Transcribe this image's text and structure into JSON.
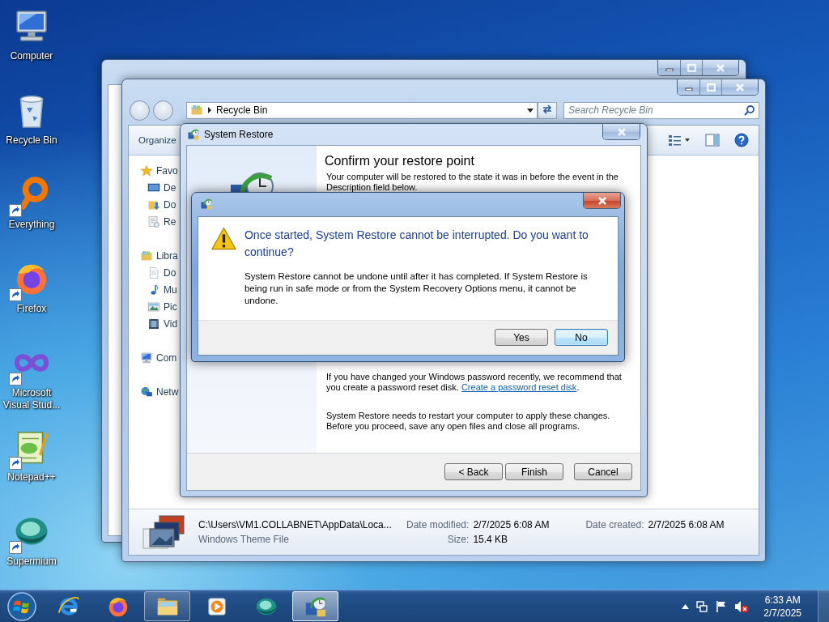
{
  "desktop_icons": [
    {
      "label": "Computer",
      "kind": "computer",
      "shortcut": false
    },
    {
      "label": "Recycle Bin",
      "kind": "recycle-bin",
      "shortcut": false
    },
    {
      "label": "Everything",
      "kind": "ring",
      "shortcut": true
    },
    {
      "label": "Firefox",
      "kind": "firefox",
      "shortcut": true
    },
    {
      "label": "Microsoft Visual Stud...",
      "kind": "infinity",
      "shortcut": true
    },
    {
      "label": "Notepad++",
      "kind": "notepad",
      "shortcut": true
    },
    {
      "label": "Supermium",
      "kind": "orb",
      "shortcut": true
    }
  ],
  "explorer": {
    "address": "Recycle Bin",
    "search": {
      "placeholder": "Search Recycle Bin"
    },
    "toolbar": [
      "Organize"
    ],
    "nav": [
      {
        "label": "Favo",
        "kind": "star",
        "children": [
          {
            "label": "De",
            "kind": "desktop"
          },
          {
            "label": "Do",
            "kind": "downloads"
          },
          {
            "label": "Re",
            "kind": "recent"
          }
        ]
      },
      {
        "label": "Libra",
        "kind": "library",
        "children": [
          {
            "label": "Do",
            "kind": "document"
          },
          {
            "label": "Mu",
            "kind": "music"
          },
          {
            "label": "Pic",
            "kind": "pictures"
          },
          {
            "label": "Vid",
            "kind": "videos"
          }
        ]
      },
      {
        "label": "Com",
        "kind": "computer"
      },
      {
        "label": "Netw",
        "kind": "network"
      }
    ],
    "details": {
      "path": "C:\\Users\\VM1.COLLABNET\\AppData\\Loca...",
      "type": "Windows Theme File",
      "fields": [
        {
          "label": "Date modified:",
          "value": "2/7/2025 6:08 AM"
        },
        {
          "label": "Size:",
          "value": "15.4 KB"
        },
        {
          "label": "Date created:",
          "value": "2/7/2025 6:08 AM"
        }
      ]
    }
  },
  "system_restore": {
    "title": "System Restore",
    "heading": "Confirm your restore point",
    "intro": "Your computer will be restored to the state it was in before the event in the Description field below.",
    "password_note": "If you have changed your Windows password recently, we recommend that you create a password reset disk.",
    "link": "Create a password reset disk",
    "link_suffix": ".",
    "restart_note": "System Restore needs to restart your computer to apply these changes. Before you proceed, save any open files and close all programs.",
    "buttons": [
      "< Back",
      "Finish",
      "Cancel"
    ]
  },
  "confirm_dialog": {
    "heading": "Once started, System Restore cannot be interrupted. Do you want to continue?",
    "body": "System Restore cannot be undone until after it has completed. If System Restore is being run in safe mode or from the System Recovery Options menu, it cannot be undone.",
    "buttons": [
      {
        "label": "Yes",
        "default": false
      },
      {
        "label": "No",
        "default": true
      }
    ]
  },
  "taskbar": {
    "apps": [
      {
        "kind": "ie",
        "open": false,
        "selected": false
      },
      {
        "kind": "firefox",
        "open": false,
        "selected": false
      },
      {
        "kind": "folder",
        "open": true,
        "selected": false
      },
      {
        "kind": "media",
        "open": false,
        "selected": false
      },
      {
        "kind": "orb",
        "open": false,
        "selected": false
      },
      {
        "kind": "restore",
        "open": true,
        "selected": true
      }
    ],
    "clock": {
      "time": "6:33 AM",
      "date": "2/7/2025"
    }
  }
}
